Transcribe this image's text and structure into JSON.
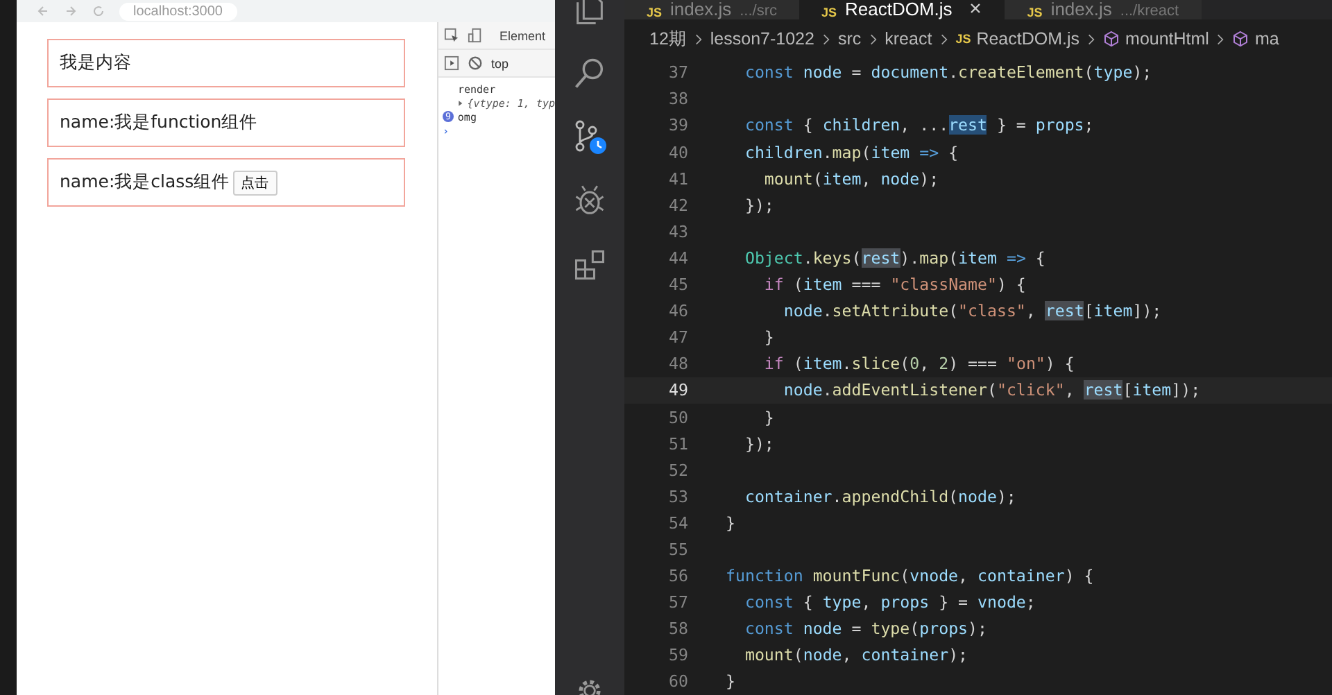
{
  "browser": {
    "address": "localhost:3000",
    "page": [
      {
        "text": "我是内容"
      },
      {
        "text": "name:我是function组件"
      },
      {
        "text": "name:我是class组件",
        "button": "点击"
      }
    ],
    "devtools": {
      "tab": "Element",
      "context": "top",
      "console": [
        {
          "kind": "log",
          "text": "render"
        },
        {
          "kind": "object",
          "text": "{vtype: 1, typ"
        },
        {
          "kind": "badge",
          "count": "9",
          "text": "omg"
        },
        {
          "kind": "prompt",
          "text": "›"
        }
      ]
    }
  },
  "editor": {
    "tabs": [
      {
        "icon_label": "JS",
        "name": "index.js",
        "path": ".../src",
        "selected": false
      },
      {
        "icon_label": "JS",
        "name": "ReactDOM.js",
        "selected": true
      },
      {
        "icon_label": "JS",
        "name": "index.js",
        "path": ".../kreact",
        "selected": false
      }
    ],
    "breadcrumb": [
      {
        "kind": "folder",
        "text": "12期"
      },
      {
        "kind": "folder",
        "text": "lesson7-1022"
      },
      {
        "kind": "folder",
        "text": "src"
      },
      {
        "kind": "folder",
        "text": "kreact"
      },
      {
        "kind": "file",
        "icon_label": "JS",
        "text": "ReactDOM.js"
      },
      {
        "kind": "symbol",
        "text": "mountHtml"
      },
      {
        "kind": "symbol",
        "text": "ma"
      }
    ],
    "lines": [
      {
        "number": "37",
        "active": false,
        "tokens": [
          {
            "text": "  const ",
            "kind": "kw"
          },
          {
            "text": "node",
            "kind": "var"
          },
          {
            "text": " = ",
            "kind": "p"
          },
          {
            "text": "document",
            "kind": "var"
          },
          {
            "text": ".",
            "kind": "p"
          },
          {
            "text": "createElement",
            "kind": "fn"
          },
          {
            "text": "(",
            "kind": "p"
          },
          {
            "text": "type",
            "kind": "var"
          },
          {
            "text": ");",
            "kind": "p"
          }
        ]
      },
      {
        "number": "38",
        "active": false
      },
      {
        "number": "39",
        "active": false,
        "tokens": [
          {
            "text": "  const ",
            "kind": "kw"
          },
          {
            "text": "{ ",
            "kind": "p"
          },
          {
            "text": "children",
            "kind": "var"
          },
          {
            "text": ", ...",
            "kind": "p"
          },
          {
            "text": "rest",
            "kind": "match"
          },
          {
            "text": " } = ",
            "kind": "p"
          },
          {
            "text": "props",
            "kind": "var"
          },
          {
            "text": ";",
            "kind": "p"
          }
        ]
      },
      {
        "number": "40",
        "active": false,
        "tokens": [
          {
            "text": "  children",
            "kind": "var"
          },
          {
            "text": ".",
            "kind": "p"
          },
          {
            "text": "map",
            "kind": "fn"
          },
          {
            "text": "(",
            "kind": "p"
          },
          {
            "text": "item",
            "kind": "var"
          },
          {
            "text": " => ",
            "kind": "kw"
          },
          {
            "text": "{",
            "kind": "p"
          }
        ]
      },
      {
        "number": "41",
        "active": false,
        "tokens": [
          {
            "text": "    mount",
            "kind": "fn"
          },
          {
            "text": "(",
            "kind": "p"
          },
          {
            "text": "item",
            "kind": "var"
          },
          {
            "text": ", ",
            "kind": "p"
          },
          {
            "text": "node",
            "kind": "var"
          },
          {
            "text": ");",
            "kind": "p"
          }
        ]
      },
      {
        "number": "42",
        "active": false,
        "tokens": [
          {
            "text": "  });",
            "kind": "p"
          }
        ]
      },
      {
        "number": "43",
        "active": false
      },
      {
        "number": "44",
        "active": false,
        "tokens": [
          {
            "text": "  Object",
            "kind": "cls"
          },
          {
            "text": ".",
            "kind": "p"
          },
          {
            "text": "keys",
            "kind": "fn"
          },
          {
            "text": "(",
            "kind": "p"
          },
          {
            "text": "rest",
            "kind": "ref"
          },
          {
            "text": ").",
            "kind": "p"
          },
          {
            "text": "map",
            "kind": "fn"
          },
          {
            "text": "(",
            "kind": "p"
          },
          {
            "text": "item",
            "kind": "var"
          },
          {
            "text": " => ",
            "kind": "kw"
          },
          {
            "text": "{",
            "kind": "p"
          }
        ]
      },
      {
        "number": "45",
        "active": false,
        "tokens": [
          {
            "text": "    if ",
            "kind": "ctl"
          },
          {
            "text": "(",
            "kind": "p"
          },
          {
            "text": "item",
            "kind": "var"
          },
          {
            "text": " === ",
            "kind": "p"
          },
          {
            "text": "\"className\"",
            "kind": "str"
          },
          {
            "text": ") {",
            "kind": "p"
          }
        ]
      },
      {
        "number": "46",
        "active": false,
        "tokens": [
          {
            "text": "      node",
            "kind": "var"
          },
          {
            "text": ".",
            "kind": "p"
          },
          {
            "text": "setAttribute",
            "kind": "fn"
          },
          {
            "text": "(",
            "kind": "p"
          },
          {
            "text": "\"class\"",
            "kind": "str"
          },
          {
            "text": ", ",
            "kind": "p"
          },
          {
            "text": "rest",
            "kind": "ref"
          },
          {
            "text": "[",
            "kind": "p"
          },
          {
            "text": "item",
            "kind": "var"
          },
          {
            "text": "]);",
            "kind": "p"
          }
        ]
      },
      {
        "number": "47",
        "active": false,
        "tokens": [
          {
            "text": "    }",
            "kind": "p"
          }
        ]
      },
      {
        "number": "48",
        "active": false,
        "tokens": [
          {
            "text": "    if ",
            "kind": "ctl"
          },
          {
            "text": "(",
            "kind": "p"
          },
          {
            "text": "item",
            "kind": "var"
          },
          {
            "text": ".",
            "kind": "p"
          },
          {
            "text": "slice",
            "kind": "fn"
          },
          {
            "text": "(",
            "kind": "p"
          },
          {
            "text": "0",
            "kind": "num"
          },
          {
            "text": ", ",
            "kind": "p"
          },
          {
            "text": "2",
            "kind": "num"
          },
          {
            "text": ") === ",
            "kind": "p"
          },
          {
            "text": "\"on\"",
            "kind": "str"
          },
          {
            "text": ") {",
            "kind": "p"
          }
        ]
      },
      {
        "number": "49",
        "active": true,
        "tokens": [
          {
            "text": "      node",
            "kind": "var"
          },
          {
            "text": ".",
            "kind": "p"
          },
          {
            "text": "addEventListener",
            "kind": "fn"
          },
          {
            "text": "(",
            "kind": "p"
          },
          {
            "text": "\"click\"",
            "kind": "str"
          },
          {
            "text": ", ",
            "kind": "p"
          },
          {
            "text": "rest",
            "kind": "ref"
          },
          {
            "text": "[",
            "kind": "p"
          },
          {
            "text": "item",
            "kind": "var"
          },
          {
            "text": "]);",
            "kind": "p"
          }
        ]
      },
      {
        "number": "50",
        "active": false,
        "tokens": [
          {
            "text": "    }",
            "kind": "p"
          }
        ]
      },
      {
        "number": "51",
        "active": false,
        "tokens": [
          {
            "text": "  });",
            "kind": "p"
          }
        ]
      },
      {
        "number": "52",
        "active": false
      },
      {
        "number": "53",
        "active": false,
        "tokens": [
          {
            "text": "  container",
            "kind": "var"
          },
          {
            "text": ".",
            "kind": "p"
          },
          {
            "text": "appendChild",
            "kind": "fn"
          },
          {
            "text": "(",
            "kind": "p"
          },
          {
            "text": "node",
            "kind": "var"
          },
          {
            "text": ");",
            "kind": "p"
          }
        ]
      },
      {
        "number": "54",
        "active": false,
        "tokens": [
          {
            "text": "}",
            "kind": "p"
          }
        ]
      },
      {
        "number": "55",
        "active": false
      },
      {
        "number": "56",
        "active": false,
        "tokens": [
          {
            "text": "function ",
            "kind": "kw"
          },
          {
            "text": "mountFunc",
            "kind": "fn"
          },
          {
            "text": "(",
            "kind": "p"
          },
          {
            "text": "vnode",
            "kind": "var"
          },
          {
            "text": ", ",
            "kind": "p"
          },
          {
            "text": "container",
            "kind": "var"
          },
          {
            "text": ") {",
            "kind": "p"
          }
        ]
      },
      {
        "number": "57",
        "active": false,
        "tokens": [
          {
            "text": "  const ",
            "kind": "kw"
          },
          {
            "text": "{ ",
            "kind": "p"
          },
          {
            "text": "type",
            "kind": "var"
          },
          {
            "text": ", ",
            "kind": "p"
          },
          {
            "text": "props",
            "kind": "var"
          },
          {
            "text": " } = ",
            "kind": "p"
          },
          {
            "text": "vnode",
            "kind": "var"
          },
          {
            "text": ";",
            "kind": "p"
          }
        ]
      },
      {
        "number": "58",
        "active": false,
        "tokens": [
          {
            "text": "  const ",
            "kind": "kw"
          },
          {
            "text": "node",
            "kind": "var"
          },
          {
            "text": " = ",
            "kind": "p"
          },
          {
            "text": "type",
            "kind": "fn"
          },
          {
            "text": "(",
            "kind": "p"
          },
          {
            "text": "props",
            "kind": "var"
          },
          {
            "text": ");",
            "kind": "p"
          }
        ]
      },
      {
        "number": "59",
        "active": false,
        "tokens": [
          {
            "text": "  mount",
            "kind": "fn"
          },
          {
            "text": "(",
            "kind": "p"
          },
          {
            "text": "node",
            "kind": "var"
          },
          {
            "text": ", ",
            "kind": "p"
          },
          {
            "text": "container",
            "kind": "var"
          },
          {
            "text": ");",
            "kind": "p"
          }
        ]
      },
      {
        "number": "60",
        "active": false,
        "tokens": [
          {
            "text": "}",
            "kind": "p"
          }
        ]
      }
    ]
  }
}
